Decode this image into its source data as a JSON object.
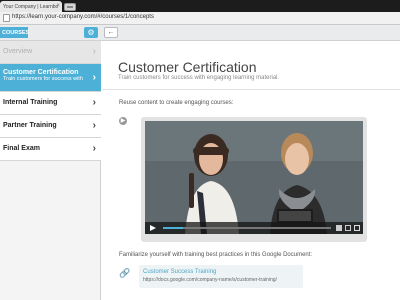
{
  "browser": {
    "tab_title": "Your Company | Learnbo",
    "url": "https://learn.your-company.com/#/courses/1/concepts"
  },
  "toolbar": {
    "courses_label": "COURSES",
    "gear_icon": "gear-icon",
    "back_icon": "arrow-left-icon"
  },
  "sidebar": {
    "items": [
      {
        "label": "Overview"
      },
      {
        "label": "Customer Certification",
        "sub": "Train customers for success with"
      },
      {
        "label": "Internal Training"
      },
      {
        "label": "Partner Training"
      },
      {
        "label": "Final Exam"
      }
    ]
  },
  "main": {
    "title": "Customer Certification",
    "subtitle": "Train customers for success with engaging learning material.",
    "reuse_text": "Reuse content to create engaging courses:",
    "video": {
      "progress": 0.12
    },
    "familiarize_text": "Familiarize yourself with training best practices in this Google Document:",
    "link": {
      "title": "Customer Success Training",
      "url": "https://docs.google.com/company-name/s/customer-training/"
    }
  },
  "colors": {
    "accent": "#4db0d6",
    "sidebar_bg": "#f4f4f4",
    "title": "#444444"
  }
}
